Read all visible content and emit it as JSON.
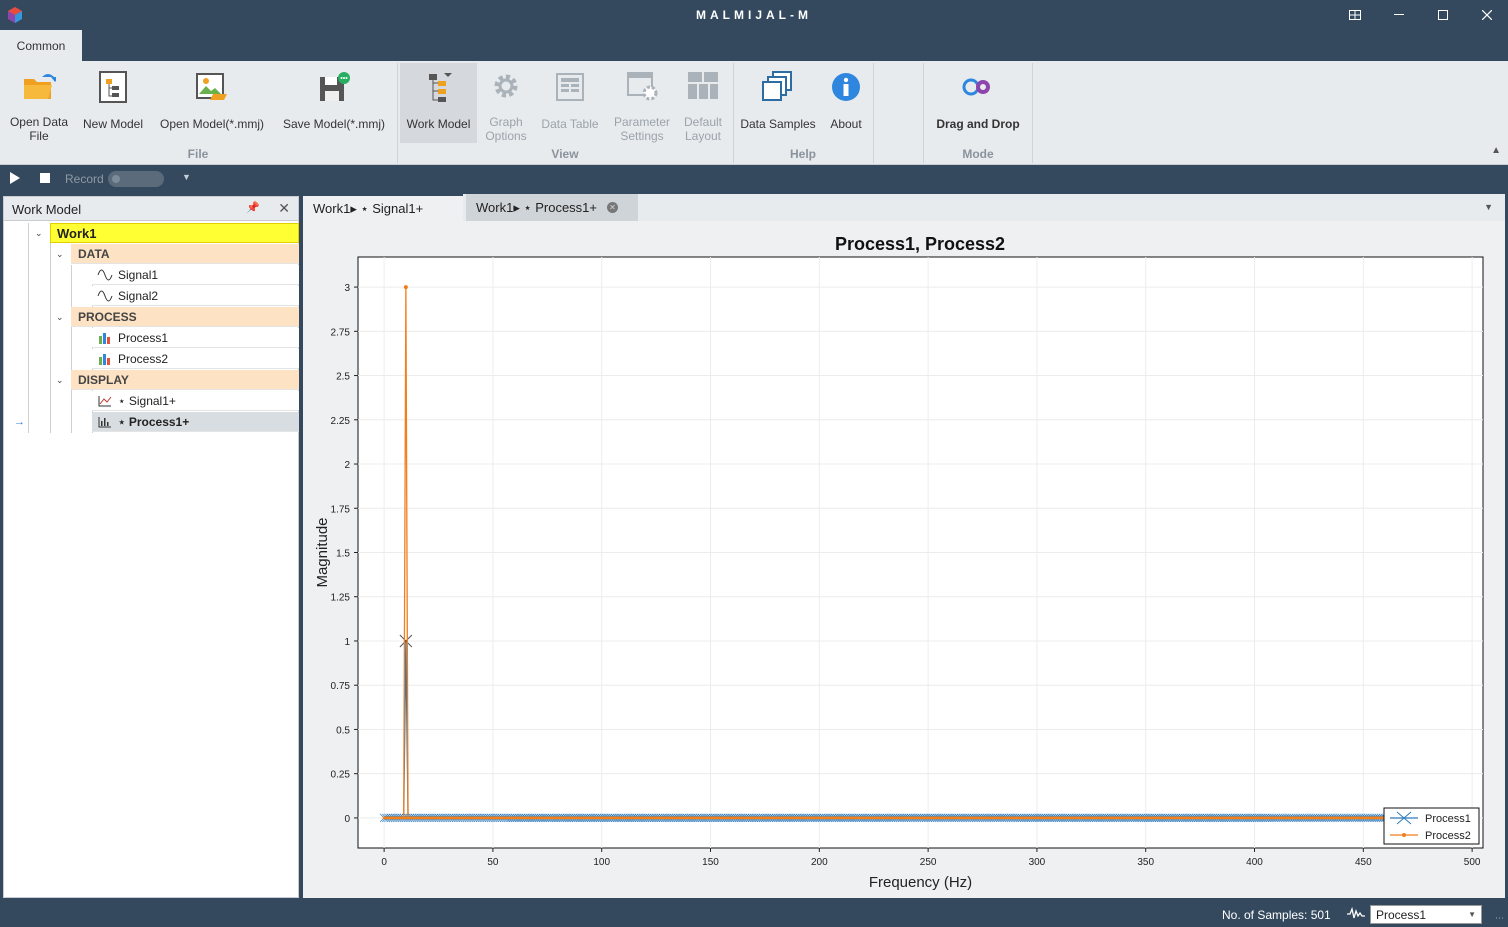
{
  "app": {
    "title": "MALMIJAL-M"
  },
  "ribbon": {
    "tab": "Common",
    "groups": {
      "file": "File",
      "view": "View",
      "help": "Help",
      "mode": "Mode"
    },
    "buttons": {
      "open_data_file": "Open Data\nFile",
      "new_model": "New Model",
      "open_model": "Open Model(*.mmj)",
      "save_model": "Save Model(*.mmj)",
      "work_model": "Work Model",
      "graph_options": "Graph\nOptions",
      "data_table": "Data Table",
      "parameter_settings": "Parameter\nSettings",
      "default_layout": "Default\nLayout",
      "data_samples": "Data Samples",
      "about": "About",
      "drag_and_drop": "Drag and Drop"
    }
  },
  "recordbar": {
    "record_label": "Record"
  },
  "work_model": {
    "title": "Work Model",
    "root": "Work1",
    "groups": [
      {
        "label": "DATA",
        "items": [
          "Signal1",
          "Signal2"
        ]
      },
      {
        "label": "PROCESS",
        "items": [
          "Process1",
          "Process2"
        ]
      },
      {
        "label": "DISPLAY",
        "items": [
          "⋆ Signal1+",
          "⋆ Process1+"
        ]
      }
    ]
  },
  "doc_tabs": [
    {
      "label": "Work1▸ ⋆ Signal1+"
    },
    {
      "label": "Work1▸ ⋆ Process1+"
    }
  ],
  "chart_data": {
    "type": "line",
    "title": "Process1, Process2",
    "xlabel": "Frequency (Hz)",
    "ylabel": "Magnitude",
    "xlim": [
      -12,
      505
    ],
    "ylim": [
      -0.17,
      3.17
    ],
    "xticks": [
      0,
      50,
      100,
      150,
      200,
      250,
      300,
      350,
      400,
      450,
      500
    ],
    "yticks": [
      0,
      0.25,
      0.5,
      0.75,
      1,
      1.25,
      1.5,
      1.75,
      2,
      2.25,
      2.5,
      2.75,
      3
    ],
    "grid": true,
    "legend": "bottom-right",
    "series": [
      {
        "name": "Process1",
        "color": "#2e7bbd",
        "marker": "x",
        "spike_x": 10,
        "spike_y": 1,
        "baseline": 0,
        "x_range": [
          0,
          500
        ],
        "step": 1
      },
      {
        "name": "Process2",
        "color": "#f07f1c",
        "marker": "dot",
        "spike_x": 10,
        "spike_y": 3,
        "baseline": 0,
        "x_range": [
          0,
          500
        ],
        "step": 1
      }
    ]
  },
  "status": {
    "samples": "No. of Samples: 501",
    "selected_process": "Process1"
  },
  "colors": {
    "chrome": "#34495e",
    "ribbon": "#e8ebee",
    "root_highlight": "#ffff33",
    "group_bg": "#fde2c4"
  }
}
